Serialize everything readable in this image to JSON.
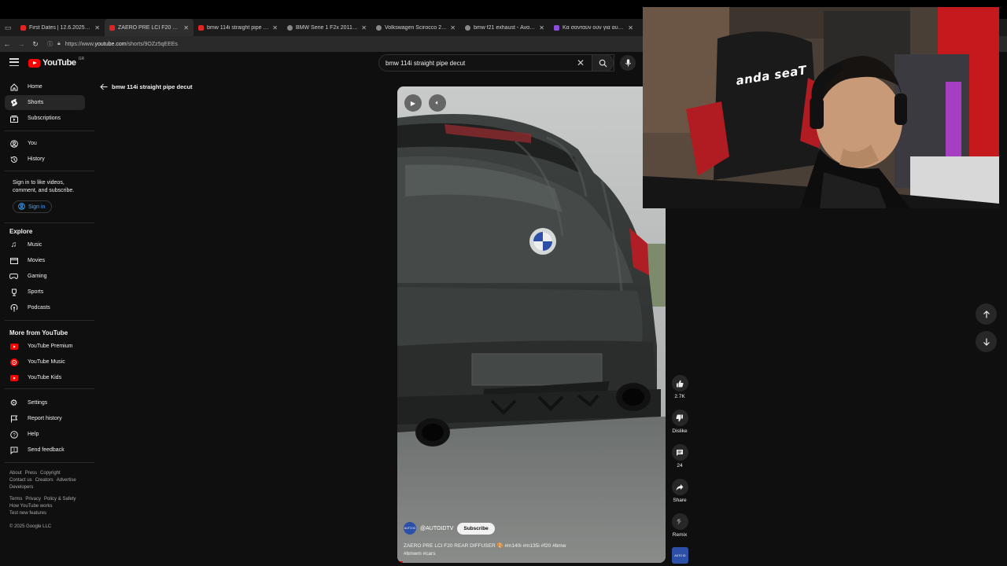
{
  "browser": {
    "tabs": [
      {
        "title": "First Dates | 12.6.2025 - YouTube",
        "icon": "youtube-icon",
        "active": false
      },
      {
        "title": "ZAERO PRE LCI F20 REAR DIFFUS",
        "icon": "youtube-icon",
        "active": true
      },
      {
        "title": "bmw 114i straight pipe decut",
        "icon": "youtube-icon",
        "active": false
      },
      {
        "title": "BMW Serie 1 F2x 2011 - 2015 1",
        "icon": "site-icon",
        "active": false
      },
      {
        "title": "Volkswagen Scirocco 2008 - 20",
        "icon": "site-icon",
        "active": false
      },
      {
        "title": "bmw f21 exhaust - Αναζήτηση",
        "icon": "google-icon",
        "active": false
      },
      {
        "title": "Κα σανταύν ούν για αυτοκίν",
        "icon": "site-icon",
        "active": false
      }
    ],
    "url_prefix": "https://www.",
    "url_host": "youtube.com",
    "url_path": "/shorts/9OZz5qEEEs"
  },
  "youtube": {
    "logo_text": "YouTube",
    "country_code": "GR",
    "search_value": "bmw 114i straight pipe decut"
  },
  "sidebar": {
    "main": [
      {
        "label": "Home",
        "icon": "home-icon"
      },
      {
        "label": "Shorts",
        "icon": "shorts-icon"
      },
      {
        "label": "Subscriptions",
        "icon": "subscriptions-icon"
      }
    ],
    "you": [
      {
        "label": "You",
        "icon": "you-icon"
      },
      {
        "label": "History",
        "icon": "history-icon"
      }
    ],
    "signin_note": "Sign in to like videos, comment, and subscribe.",
    "signin_label": "Sign in",
    "explore_heading": "Explore",
    "explore": [
      {
        "label": "Music",
        "icon": "music-icon"
      },
      {
        "label": "Movies",
        "icon": "movies-icon"
      },
      {
        "label": "Gaming",
        "icon": "gaming-icon"
      },
      {
        "label": "Sports",
        "icon": "sports-icon"
      },
      {
        "label": "Podcasts",
        "icon": "podcasts-icon"
      }
    ],
    "more_heading": "More from YouTube",
    "more": [
      {
        "label": "YouTube Premium",
        "icon": "youtube-premium-icon"
      },
      {
        "label": "YouTube Music",
        "icon": "youtube-music-icon"
      },
      {
        "label": "YouTube Kids",
        "icon": "youtube-kids-icon"
      }
    ],
    "settings": [
      {
        "label": "Settings",
        "icon": "settings-icon"
      },
      {
        "label": "Report history",
        "icon": "flag-icon"
      },
      {
        "label": "Help",
        "icon": "help-icon"
      },
      {
        "label": "Send feedback",
        "icon": "feedback-icon"
      }
    ],
    "footer_line1": [
      "About",
      "Press",
      "Copyright"
    ],
    "footer_line2": [
      "Contact us",
      "Creators",
      "Advertise"
    ],
    "footer_line3": [
      "Developers"
    ],
    "footer_line4": [
      "Terms",
      "Privacy",
      "Policy & Safety"
    ],
    "footer_line5": [
      "How YouTube works"
    ],
    "footer_line6": [
      "Test new features"
    ],
    "copyright": "© 2025 Google LLC"
  },
  "shorts": {
    "back_title": "bmw 114i straight pipe decut",
    "channel_handle": "@AUTOIDTV",
    "channel_avatar_text": "AUTO ID",
    "subscribe_label": "Subscribe",
    "caption_line1": "ZAERO PRE LCI F20 REAR DIFFUSER 🎨 #m140i #m135i #f20 #bmw",
    "caption_line2": "#bmwm #cars",
    "progress_fraction": 0.02,
    "actions": {
      "like_count": "2.7K",
      "dislike_label": "Dislike",
      "comment_count": "24",
      "share_label": "Share",
      "remix_label": "Remix"
    }
  },
  "webcam": {
    "chair_brand": "anda seaT"
  },
  "colors": {
    "accent": "#ff0000",
    "link": "#3ea6ff",
    "background": "#0f0f0f"
  }
}
